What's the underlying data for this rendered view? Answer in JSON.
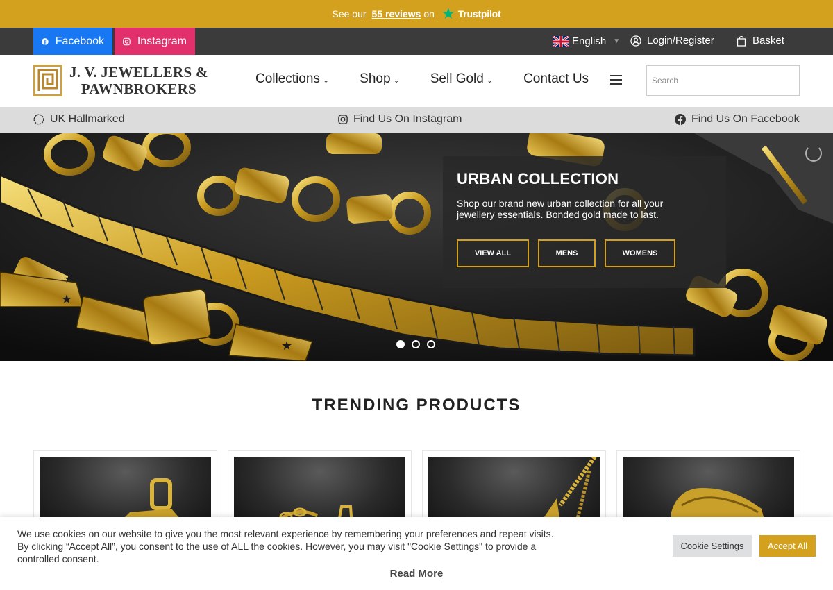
{
  "trustpilot": {
    "prefix": "See our",
    "count": "55 reviews",
    "suffix": "on",
    "brand": "Trustpilot"
  },
  "topbar": {
    "facebook": "Facebook",
    "instagram": "Instagram",
    "language": "English",
    "login": "Login/Register",
    "basket": "Basket"
  },
  "header": {
    "logo_line1": "J. V. JEWELLERS &",
    "logo_line2": "PAWNBROKERS",
    "nav": [
      {
        "label": "Collections"
      },
      {
        "label": "Shop"
      },
      {
        "label": "Sell Gold"
      },
      {
        "label": "Contact Us"
      }
    ],
    "search_placeholder": "Search"
  },
  "infobar": {
    "hallmarked": "UK Hallmarked",
    "instagram": "Find Us On Instagram",
    "facebook": "Find Us On Facebook"
  },
  "hero": {
    "title": "URBAN COLLECTION",
    "text": "Shop our brand new urban collection for all your jewellery essentials. Bonded gold made to last.",
    "buttons": [
      "VIEW ALL",
      "MENS",
      "WOMENS"
    ],
    "slide_count": 3,
    "active_slide": 1
  },
  "trending": {
    "title": "TRENDING PRODUCTS"
  },
  "cookie": {
    "text": "We use cookies on our website to give you the most relevant experience by remembering your preferences and repeat visits. By clicking “Accept All”, you consent to the use of ALL the cookies. However, you may visit \"Cookie Settings\" to provide a controlled consent.",
    "settings": "Cookie Settings",
    "accept": "Accept All",
    "read_more": "Read More"
  },
  "colors": {
    "gold": "#d4a11f",
    "dark": "#3b3b3b",
    "facebook": "#1877f2",
    "instagram": "#e1306c",
    "trustpilot": "#00b67a"
  }
}
